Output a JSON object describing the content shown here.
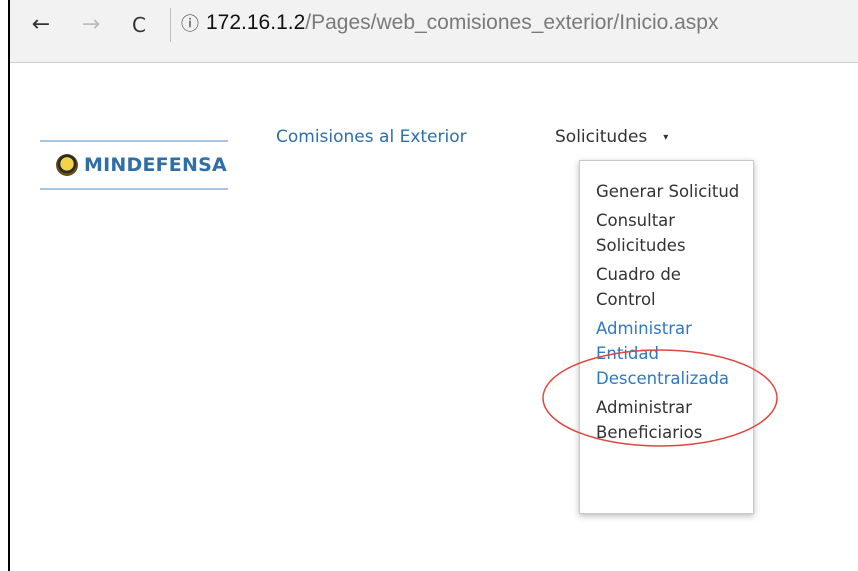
{
  "browser": {
    "back_icon": "←",
    "forward_icon": "→",
    "reload_icon": "C",
    "info_icon": "ⓘ",
    "url_host": "172.16.1.2",
    "url_path": "/Pages/web_comisiones_exterior/Inicio.aspx"
  },
  "header": {
    "logo_text": "MINDEFENSA",
    "app_link": "Comisiones al Exterior",
    "menu_label": "Solicitudes",
    "menu_caret": "▾"
  },
  "dropdown": {
    "items": [
      {
        "label": "Generar Solicitud"
      },
      {
        "label": "Consultar Solicitudes"
      },
      {
        "label": "Cuadro de Control"
      },
      {
        "label": "Administrar Entidad Descentralizada"
      },
      {
        "label": "Administrar Beneficiarios"
      }
    ]
  },
  "colors": {
    "link_blue": "#2f6ea7",
    "highlight_blue": "#2f78c4",
    "annotation_red": "#e0463f"
  }
}
